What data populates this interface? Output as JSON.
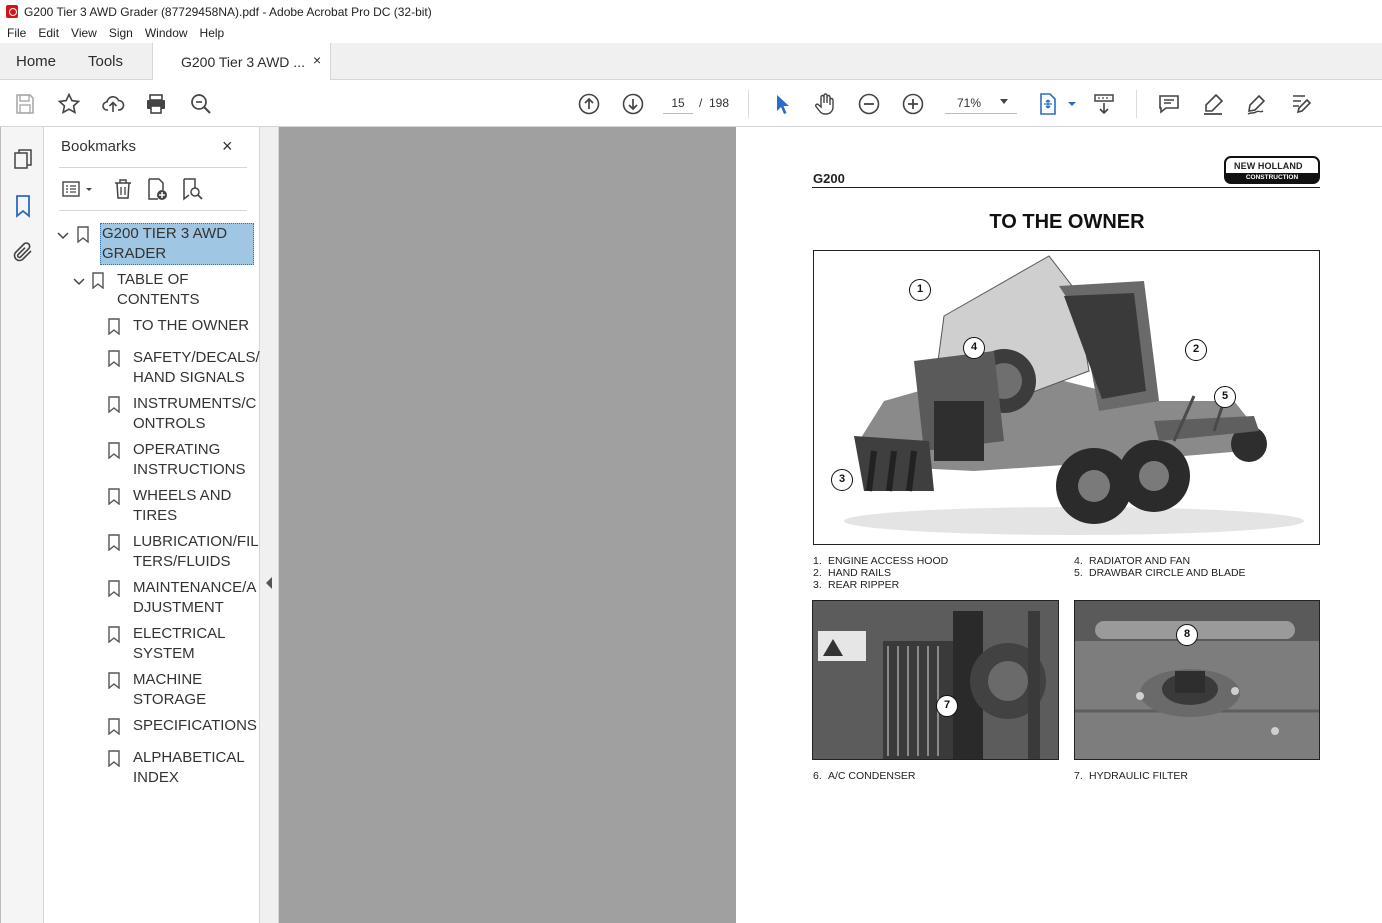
{
  "window": {
    "title": "G200 Tier 3 AWD Grader (87729458NA).pdf - Adobe Acrobat Pro DC (32-bit)"
  },
  "menu": [
    "File",
    "Edit",
    "View",
    "Sign",
    "Window",
    "Help"
  ],
  "tabs": {
    "home": "Home",
    "tools": "Tools",
    "document": "G200 Tier 3 AWD ...",
    "close": "×"
  },
  "toolbar": {
    "page_current": "15",
    "page_separator": "/",
    "page_total": "198",
    "zoom": "71%"
  },
  "bookmarks": {
    "title": "Bookmarks",
    "close": "×",
    "root": {
      "line1": "G200 TIER 3 AWD",
      "line2": "GRADER"
    },
    "toc": {
      "line1": "TABLE OF",
      "line2": "CONTENTS"
    },
    "items": [
      {
        "line1": "TO THE OWNER",
        "line2": ""
      },
      {
        "line1": "SAFETY/DECALS/",
        "line2": "HAND SIGNALS"
      },
      {
        "line1": "INSTRUMENTS/C",
        "line2": "ONTROLS"
      },
      {
        "line1": "OPERATING",
        "line2": "INSTRUCTIONS"
      },
      {
        "line1": "WHEELS AND",
        "line2": "TIRES"
      },
      {
        "line1": "LUBRICATION/FIL",
        "line2": "TERS/FLUIDS"
      },
      {
        "line1": "MAINTENANCE/A",
        "line2": "DJUSTMENT"
      },
      {
        "line1": "ELECTRICAL",
        "line2": "SYSTEM"
      },
      {
        "line1": "MACHINE",
        "line2": "STORAGE"
      },
      {
        "line1": "SPECIFICATIONS",
        "line2": ""
      },
      {
        "line1": "ALPHABETICAL",
        "line2": "INDEX"
      }
    ]
  },
  "page": {
    "model": "G200",
    "logo_top": "NEW HOLLAND",
    "logo_bottom": "CONSTRUCTION",
    "heading": "TO THE OWNER",
    "callouts": [
      "1",
      "2",
      "3",
      "4",
      "5",
      "7",
      "8"
    ],
    "captions_left": [
      {
        "num": "1.",
        "text": "ENGINE ACCESS HOOD"
      },
      {
        "num": "2.",
        "text": "HAND RAILS"
      },
      {
        "num": "3.",
        "text": "REAR RIPPER"
      }
    ],
    "captions_right": [
      {
        "num": "4.",
        "text": "RADIATOR AND FAN"
      },
      {
        "num": "5.",
        "text": "DRAWBAR CIRCLE AND BLADE"
      }
    ],
    "caption_6": {
      "num": "6.",
      "text": "A/C CONDENSER"
    },
    "caption_7": {
      "num": "7.",
      "text": "HYDRAULIC FILTER"
    }
  },
  "colors": {
    "selected_bookmark": "#9fc6e3",
    "viewer_bg": "#a0a0a0",
    "accent": "#2b6cc4"
  }
}
